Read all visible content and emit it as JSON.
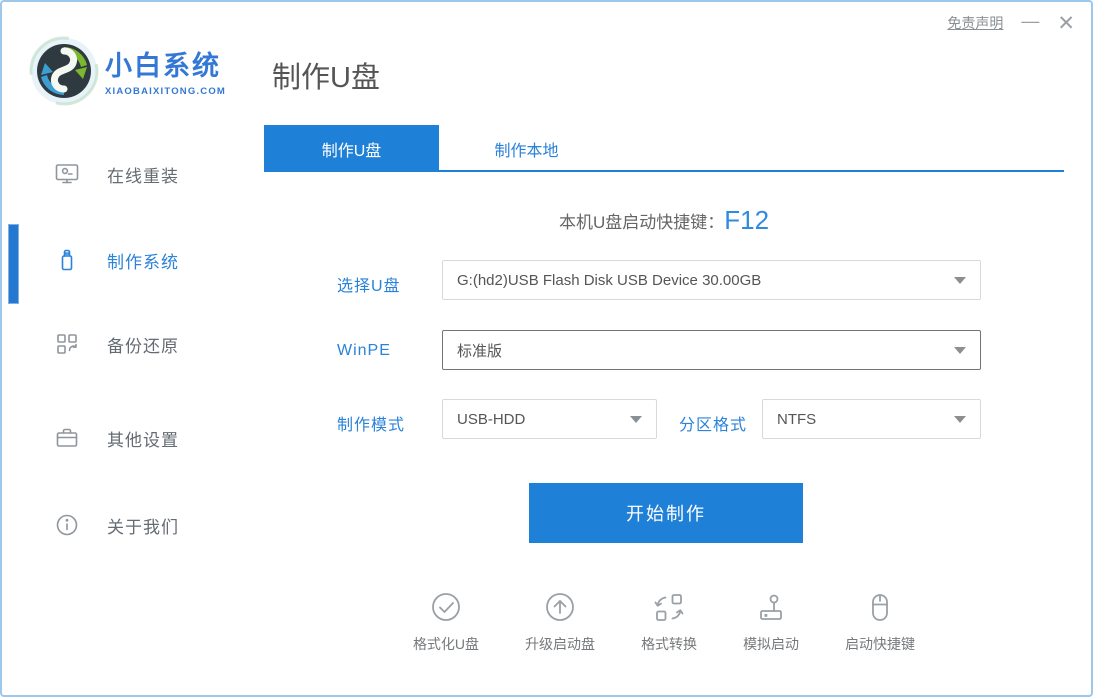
{
  "window": {
    "disclaimer": "免责声明",
    "minimize": "—",
    "close": "✕"
  },
  "header": {
    "brand_name": "小白系统",
    "brand_domain": "XIAOBAIXITONG.COM",
    "page_title": "制作U盘"
  },
  "sidebar": {
    "items": [
      {
        "label": "在线重装",
        "icon": "monitor-icon",
        "active": false
      },
      {
        "label": "制作系统",
        "icon": "usb-icon",
        "active": true
      },
      {
        "label": "备份还原",
        "icon": "backup-grid-icon",
        "active": false
      },
      {
        "label": "其他设置",
        "icon": "briefcase-icon",
        "active": false
      },
      {
        "label": "关于我们",
        "icon": "info-circle-icon",
        "active": false
      }
    ]
  },
  "tabs": [
    {
      "label": "制作U盘",
      "active": true
    },
    {
      "label": "制作本地",
      "active": false
    }
  ],
  "main": {
    "hotkey_label": "本机U盘启动快捷键：",
    "hotkey_value": "F12",
    "fields": {
      "usb": {
        "label": "选择U盘",
        "value": "G:(hd2)USB Flash Disk USB Device 30.00GB"
      },
      "winpe": {
        "label": "WinPE",
        "value": "标准版"
      },
      "mode": {
        "label": "制作模式",
        "value": "USB-HDD"
      },
      "partition": {
        "label": "分区格式",
        "value": "NTFS"
      }
    },
    "start_button": "开始制作"
  },
  "tools": [
    {
      "label": "格式化U盘",
      "icon": "check-circle-icon"
    },
    {
      "label": "升级启动盘",
      "icon": "arrow-up-circle-icon"
    },
    {
      "label": "格式转换",
      "icon": "convert-icon"
    },
    {
      "label": "模拟启动",
      "icon": "joystick-icon"
    },
    {
      "label": "启动快捷键",
      "icon": "mouse-icon"
    }
  ],
  "colors": {
    "primary_blue": "#1f80d8",
    "label_blue": "#2b82d9",
    "brand_blue": "#3378d4",
    "border_blue": "#9ec7ec",
    "gray_text": "#666666",
    "icon_gray": "#9aa0a6"
  }
}
